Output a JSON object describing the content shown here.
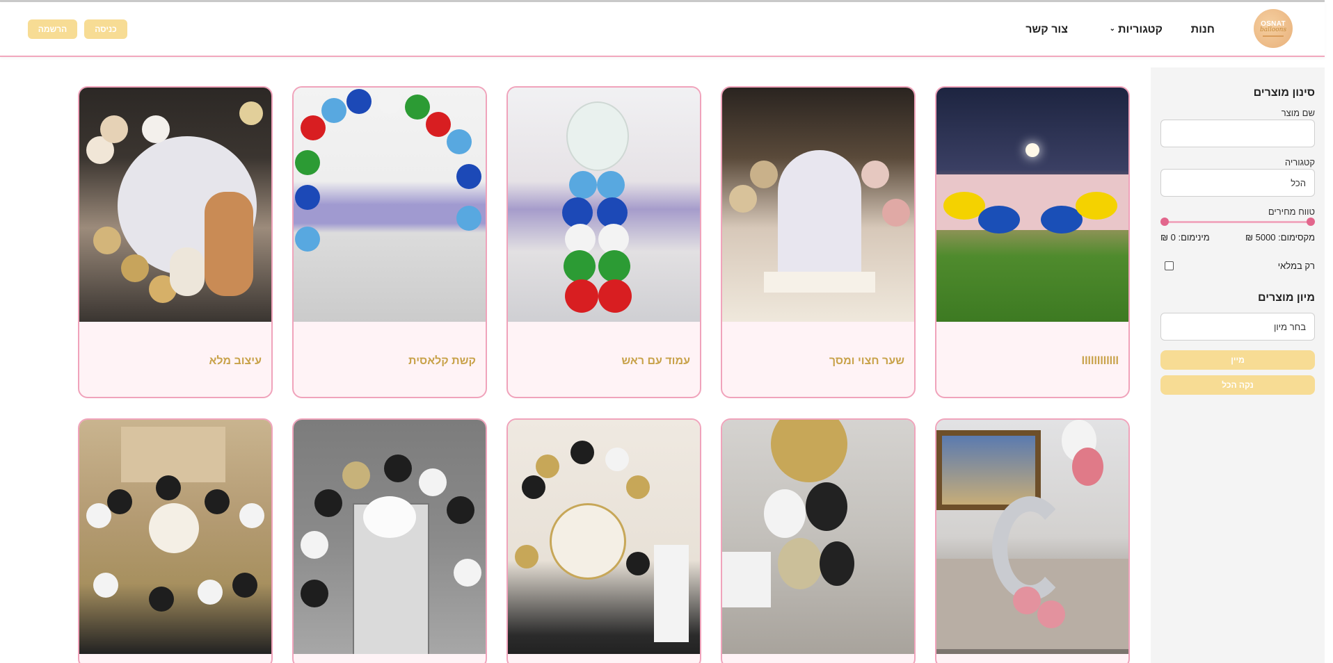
{
  "header": {
    "logo": {
      "line1": "OSNAT",
      "line2": "balloons"
    },
    "nav": {
      "shop": "חנות",
      "categories": "קטגוריות",
      "contact": "צור קשר"
    },
    "login": "כניסה",
    "register": "הרשמה"
  },
  "sidebar": {
    "title": "סינון מוצרים",
    "product_name_label": "שם מוצר",
    "product_name_value": "",
    "category_label": "קטגוריה",
    "category_value": "הכל",
    "price_range_label": "טווח מחירים",
    "price_max": "מקסימום: 5000 ₪",
    "price_min": "מינימום: 0 ₪",
    "in_stock_label": "רק במלאי",
    "sort_title": "מיון מוצרים",
    "sort_value": "בחר מיון",
    "sort_button": "מיין",
    "clear_button": "נקה הכל"
  },
  "products": [
    {
      "name": "llllllllllll"
    },
    {
      "name": "שער חצוי ומסך"
    },
    {
      "name": "עמוד עם ראש"
    },
    {
      "name": "קשת קלאסית"
    },
    {
      "name": "עיצוב מלא"
    },
    {
      "name": ""
    },
    {
      "name": ""
    },
    {
      "name": ""
    },
    {
      "name": ""
    },
    {
      "name": ""
    }
  ],
  "images": {
    "p1_text": "",
    "p2_text": "",
    "p3_text": "",
    "p6_label": ""
  }
}
